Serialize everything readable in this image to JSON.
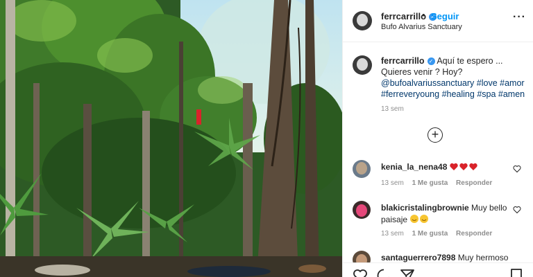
{
  "header": {
    "username": "ferrcarrillo",
    "separator": "•",
    "follow_label": "Seguir",
    "location": "Bufo Alvarius Sanctuary",
    "more_icon": "more-options-icon"
  },
  "caption": {
    "username": "ferrcarrillo",
    "line1": "Aquí te espero ...",
    "line2": "Quieres venir ? Hoy?",
    "mention": "@bufoalvariussanctuary",
    "tags": [
      "#love",
      "#amor",
      "#ferreveryoung",
      "#healing",
      "#spa",
      "#amen"
    ],
    "time": "13 sem"
  },
  "load_more_icon": "plus-circle-icon",
  "comments": [
    {
      "username": "kenia_la_nena48",
      "text": "",
      "emoji": "heart x3",
      "time": "13 sem",
      "likes": "1 Me gusta",
      "reply": "Responder"
    },
    {
      "username": "blakicristalingbrownie",
      "text": "Muy bello paisaje",
      "emoji": "smiling faces x2",
      "time": "13 sem",
      "likes": "1 Me gusta",
      "reply": "Responder"
    },
    {
      "username": "santaguerrero7898",
      "text": "Muy hermoso"
    }
  ],
  "colors": {
    "accent": "#0095f6",
    "verified": "#3897f0",
    "hashtag": "#00376b",
    "muted": "#8e8e8e",
    "heart_red": "#ed4956"
  },
  "actions": [
    "heart-icon",
    "comment-icon",
    "share-icon",
    "bookmark-icon"
  ]
}
